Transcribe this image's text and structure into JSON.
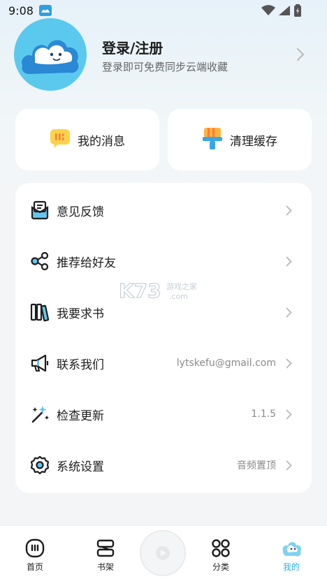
{
  "status_bar": {
    "time": "9:08",
    "icons": [
      "app-notification-icon",
      "wifi-icon",
      "cellular-signal-icon",
      "battery-icon"
    ]
  },
  "profile": {
    "title": "登录/注册",
    "subtitle": "登录即可免费同步云端收藏",
    "avatar_icon": "cloud-mascot-icon"
  },
  "quick_actions": [
    {
      "label": "我的消息",
      "icon": "message-icon"
    },
    {
      "label": "清理缓存",
      "icon": "clean-brush-icon"
    }
  ],
  "menu": [
    {
      "label": "意见反馈",
      "value": "",
      "icon": "feedback-icon"
    },
    {
      "label": "推荐给好友",
      "value": "",
      "icon": "share-icon"
    },
    {
      "label": "我要求书",
      "value": "",
      "icon": "books-icon"
    },
    {
      "label": "联系我们",
      "value": "lytskefu@gmail.com",
      "icon": "megaphone-icon"
    },
    {
      "label": "检查更新",
      "value": "1.1.5",
      "icon": "magic-wand-icon"
    },
    {
      "label": "系统设置",
      "value": "音频置顶",
      "icon": "gear-icon"
    }
  ],
  "tabs": [
    {
      "label": "首页",
      "icon": "home-icon",
      "active": false
    },
    {
      "label": "书架",
      "icon": "bookshelf-icon",
      "active": false
    },
    {
      "label": "分类",
      "icon": "category-grid-icon",
      "active": false
    },
    {
      "label": "我的",
      "icon": "mascot-profile-icon",
      "active": true
    }
  ],
  "colors": {
    "accent": "#2ab3e6",
    "avatar_bg": "#5bc9ed",
    "text_primary": "#1d1d1f",
    "text_secondary": "#8a8a8a"
  }
}
